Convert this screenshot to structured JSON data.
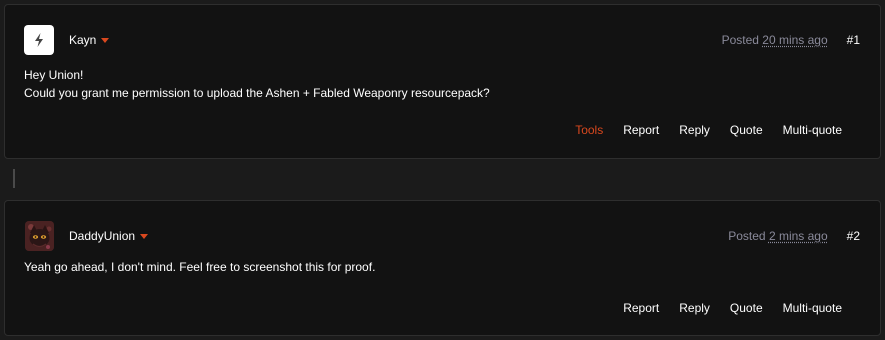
{
  "posts": [
    {
      "username": "Kayn",
      "posted_prefix": "Posted ",
      "posted_time": "20 mins ago",
      "post_number": "#1",
      "body_lines": [
        "Hey Union!",
        "Could you grant me permission to upload the Ashen + Fabled Weaponry resourcepack?"
      ],
      "actions": [
        "Tools",
        "Report",
        "Reply",
        "Quote",
        "Multi-quote"
      ],
      "avatar_icon": "lightning-bolt-icon"
    },
    {
      "username": "DaddyUnion",
      "posted_prefix": "Posted ",
      "posted_time": "2 mins ago",
      "post_number": "#2",
      "body_lines": [
        "Yeah go ahead, I don't mind. Feel free to screenshot this for proof."
      ],
      "actions": [
        "Report",
        "Reply",
        "Quote",
        "Multi-quote"
      ],
      "avatar_icon": "character-avatar"
    }
  ],
  "colors": {
    "accent": "#d9481e",
    "background": "#121212",
    "page_background": "#1b1b1b",
    "muted_text": "#8a8a9a"
  }
}
